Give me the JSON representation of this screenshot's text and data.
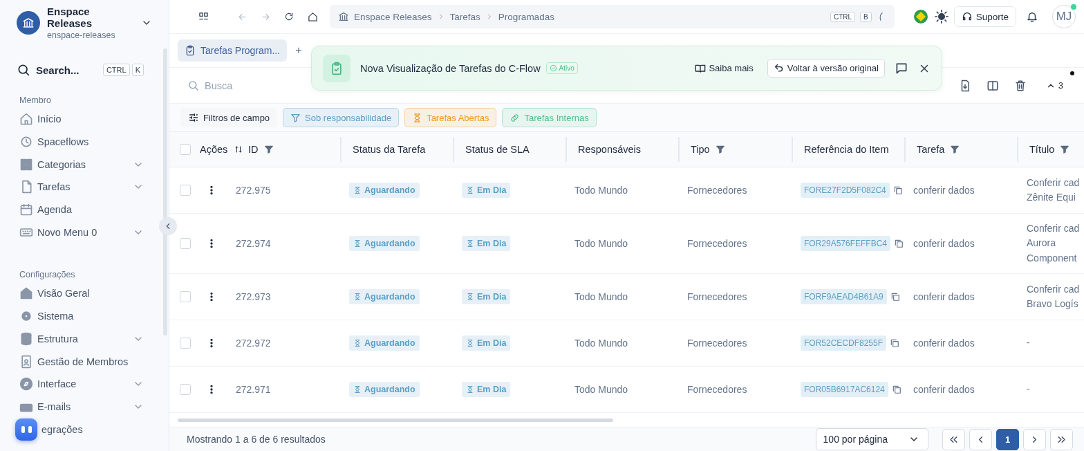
{
  "workspace": {
    "name": "Enspace Releases",
    "slug": "enspace-releases"
  },
  "sidebar": {
    "search": {
      "placeholder": "Search...",
      "keys": [
        "CTRL",
        "K"
      ]
    },
    "sections": [
      {
        "title": "Membro",
        "items": [
          {
            "label": "Início",
            "expandable": false
          },
          {
            "label": "Spaceflows",
            "expandable": false
          },
          {
            "label": "Categorias",
            "expandable": true
          },
          {
            "label": "Tarefas",
            "expandable": true
          },
          {
            "label": "Agenda",
            "expandable": false
          },
          {
            "label": "Novo Menu 0",
            "expandable": true
          }
        ]
      },
      {
        "title": "Configurações",
        "items": [
          {
            "label": "Visão Geral",
            "expandable": false
          },
          {
            "label": "Sistema",
            "expandable": false
          },
          {
            "label": "Estrutura",
            "expandable": true
          },
          {
            "label": "Gestão de Membros",
            "expandable": false
          },
          {
            "label": "Interface",
            "expandable": true
          },
          {
            "label": "E-mails",
            "expandable": true
          },
          {
            "label": "egrações",
            "expandable": false
          }
        ]
      }
    ]
  },
  "breadcrumb": [
    "Enspace Releases",
    "Tarefas",
    "Programadas"
  ],
  "shortcut": [
    "CTRL",
    "B"
  ],
  "support_button": "Suporte",
  "avatar": "MJ",
  "tabs": [
    {
      "label": "Tarefas Program...",
      "selected": true
    }
  ],
  "add_tab": "+",
  "banner": {
    "title": "Nova Visualização de Tarefas do C-Flow",
    "badge": "Ativo",
    "learn_more": "Saiba mais",
    "revert": "Voltar à versão original"
  },
  "search": {
    "placeholder": "Busca"
  },
  "collapse_count": "3",
  "filters": [
    {
      "label": "Filtros de campo",
      "kind": "settings"
    },
    {
      "label": "Sob responsabilidade",
      "kind": "funnel",
      "color": "#5b9fc4"
    },
    {
      "label": "Tarefas Abertas",
      "kind": "hourglass",
      "color": "#eb9a1e"
    },
    {
      "label": "Tarefas Internas",
      "kind": "link",
      "color": "#4fbf8a"
    }
  ],
  "table": {
    "select_all": {
      "checked": false
    },
    "columns": [
      {
        "label": "Ações"
      },
      {
        "label": "ID",
        "filter": true,
        "sort": true
      },
      {
        "label": "Status da Tarefa",
        "filter": false,
        "sort": false
      },
      {
        "label": "Status de SLA",
        "filter": false,
        "sort": false
      },
      {
        "label": "Responsáveis",
        "filter": false,
        "sort": false
      },
      {
        "label": "Tipo",
        "filter": true,
        "sort": false
      },
      {
        "label": "Referência do Item",
        "filter": false,
        "sort": false
      },
      {
        "label": "Tarefa",
        "filter": true,
        "sort": false
      },
      {
        "label": "Título",
        "filter": true,
        "sort": false
      }
    ],
    "rows": [
      {
        "checked": false,
        "id": "272.975",
        "status": "Aguardando",
        "sla": "Em Dia",
        "responsible": "Todo Mundo",
        "type": "Fornecedores",
        "reference": "FORE27F2D5F082C4",
        "task": "conferir dados",
        "title": [
          "Conferir cad",
          "Zênite Equi"
        ]
      },
      {
        "checked": false,
        "id": "272.974",
        "status": "Aguardando",
        "sla": "Em Dia",
        "responsible": "Todo Mundo",
        "type": "Fornecedores",
        "reference": "FOR29A576FEFFBC4",
        "task": "conferir dados",
        "title": [
          "Conferir cad",
          "Aurora",
          "Component"
        ]
      },
      {
        "checked": false,
        "id": "272.973",
        "status": "Aguardando",
        "sla": "Em Dia",
        "responsible": "Todo Mundo",
        "type": "Fornecedores",
        "reference": "FORF9AEAD4B61A9",
        "task": "conferir dados",
        "title": [
          "Conferir cad",
          "Bravo Logís"
        ]
      },
      {
        "checked": false,
        "id": "272.972",
        "status": "Aguardando",
        "sla": "Em Dia",
        "responsible": "Todo Mundo",
        "type": "Fornecedores",
        "reference": "FOR52CECDF8255F",
        "task": "conferir dados",
        "title": [
          "-"
        ]
      },
      {
        "checked": false,
        "id": "272.971",
        "status": "Aguardando",
        "sla": "Em Dia",
        "responsible": "Todo Mundo",
        "type": "Fornecedores",
        "reference": "FOR05B6917AC6124",
        "task": "conferir dados",
        "title": [
          "-"
        ]
      }
    ]
  },
  "footer": {
    "summary": "Mostrando 1 a 6 de 6 resultados",
    "page_size": "100 por página",
    "pages": [
      {
        "label": "1",
        "selected": true
      }
    ]
  }
}
